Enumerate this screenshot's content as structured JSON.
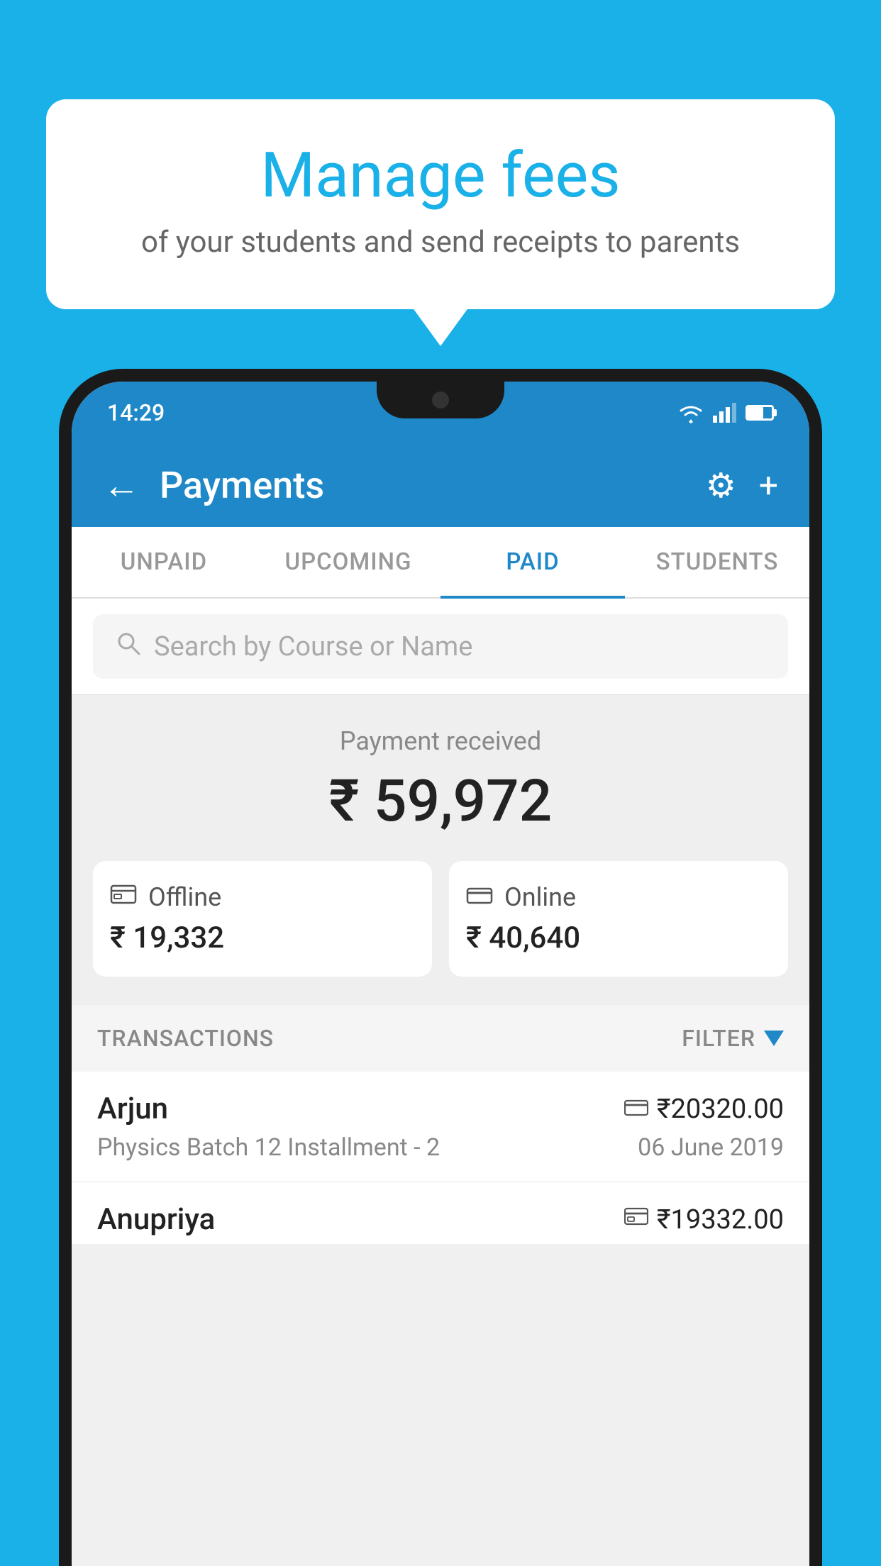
{
  "background_color": "#1ab0e8",
  "speech_bubble": {
    "title": "Manage fees",
    "subtitle": "of your students and send receipts to parents"
  },
  "status_bar": {
    "time": "14:29"
  },
  "header": {
    "title": "Payments",
    "back_label": "←",
    "gear_label": "⚙",
    "plus_label": "+"
  },
  "tabs": [
    {
      "label": "UNPAID",
      "active": false
    },
    {
      "label": "UPCOMING",
      "active": false
    },
    {
      "label": "PAID",
      "active": true
    },
    {
      "label": "STUDENTS",
      "active": false
    }
  ],
  "search": {
    "placeholder": "Search by Course or Name"
  },
  "payment_summary": {
    "received_label": "Payment received",
    "total_amount": "₹ 59,972",
    "offline_label": "Offline",
    "offline_amount": "₹ 19,332",
    "online_label": "Online",
    "online_amount": "₹ 40,640"
  },
  "transactions": {
    "section_label": "TRANSACTIONS",
    "filter_label": "FILTER",
    "rows": [
      {
        "name": "Arjun",
        "course": "Physics Batch 12 Installment - 2",
        "date": "06 June 2019",
        "amount": "₹20320.00",
        "payment_type": "online"
      },
      {
        "name": "Anupriya",
        "course": "",
        "date": "",
        "amount": "₹19332.00",
        "payment_type": "offline"
      }
    ]
  }
}
